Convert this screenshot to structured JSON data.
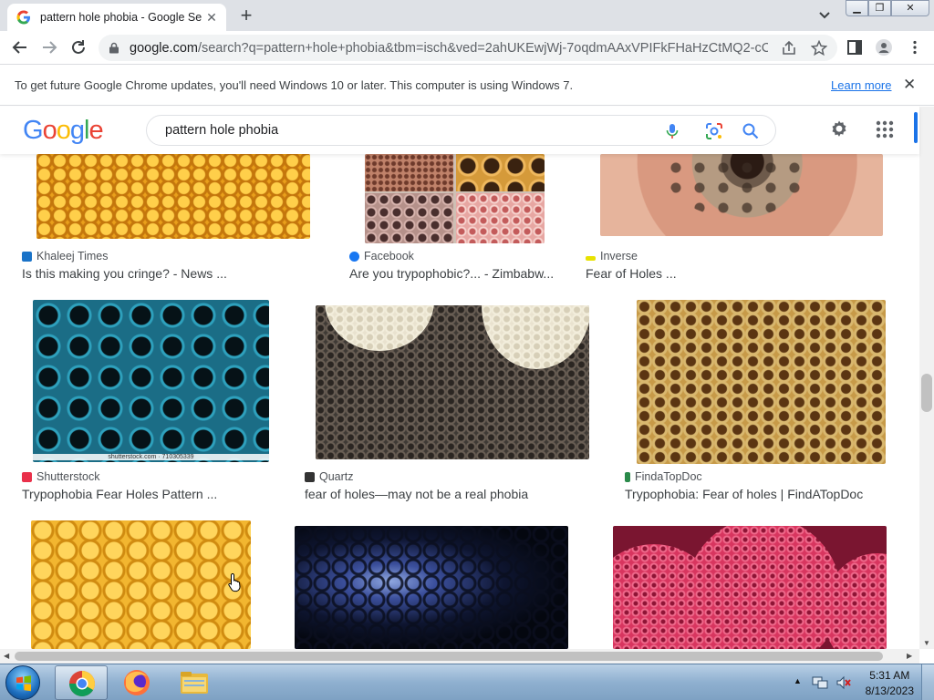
{
  "browser": {
    "tab_title": "pattern hole phobia - Google Se",
    "url_main": "google.com",
    "url_rest": "/search?q=pattern+hole+phobia&tbm=isch&ved=2ahUKEwjWj-7oqdmAAxVPIFkFHaHzCtMQ2-cCe..."
  },
  "infobar": {
    "message": "To get future Google Chrome updates, you'll need Windows 10 or later. This computer is using Windows 7.",
    "link": "Learn more"
  },
  "search": {
    "query": "pattern hole phobia"
  },
  "results": [
    {
      "source": "Khaleej Times",
      "title": "Is this making you cringe? - News ...",
      "source_color": "#1a73c8"
    },
    {
      "source": "Facebook",
      "title": "Are you trypophobic?... - Zimbabw...",
      "source_color": "#1877f2"
    },
    {
      "source": "Inverse",
      "title": "Fear of Holes ...",
      "source_color": "#e8e200"
    },
    {
      "source": "Shutterstock",
      "title": "Trypophobia Fear Holes Pattern ...",
      "source_color": "#e9304a"
    },
    {
      "source": "Quartz",
      "title": "fear of holes—may not be a real phobia",
      "source_color": "#333333"
    },
    {
      "source": "FindaTopDoc",
      "title": "Trypophobia: Fear of holes | FindATopDoc",
      "source_color": "#2a8a4a"
    }
  ],
  "watermark": "shutterstock.com · 710305339",
  "taskbar": {
    "time": "5:31 AM",
    "date": "8/13/2023"
  },
  "colors": {
    "google_blue": "#4285f4",
    "google_red": "#ea4335",
    "google_yellow": "#fbbc05",
    "google_green": "#34a853",
    "link": "#1a73e8"
  }
}
